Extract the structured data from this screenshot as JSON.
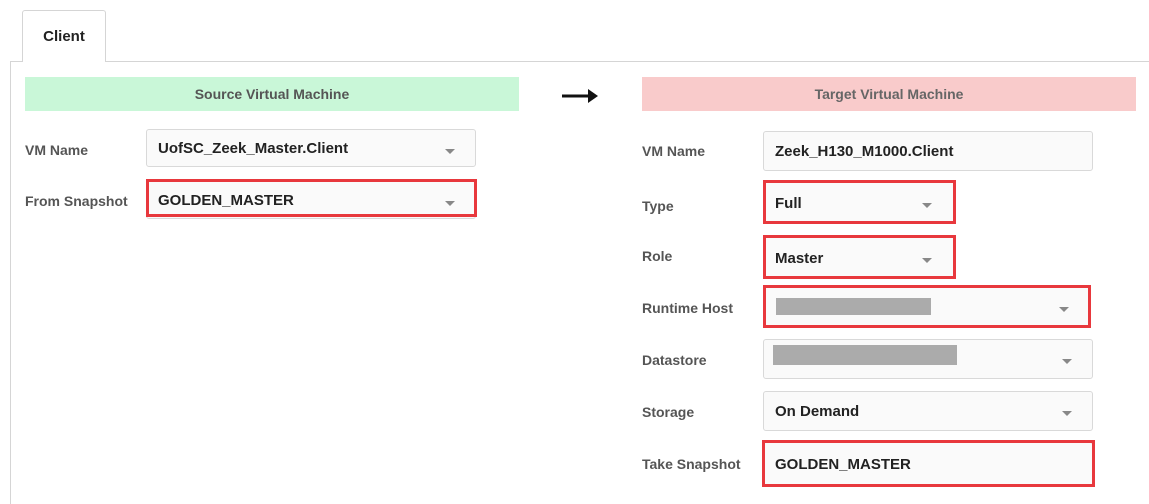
{
  "tabs": [
    {
      "label": "Client"
    }
  ],
  "source": {
    "header": "Source Virtual Machine",
    "vm_name": {
      "label": "VM Name",
      "value": "UofSC_Zeek_Master.Client"
    },
    "from_snapshot": {
      "label": "From Snapshot",
      "value": "GOLDEN_MASTER"
    }
  },
  "arrow_icon": "arrow-right-icon",
  "target": {
    "header": "Target Virtual Machine",
    "vm_name": {
      "label": "VM Name",
      "value": "Zeek_H130_M1000.Client"
    },
    "type": {
      "label": "Type",
      "value": "Full"
    },
    "role": {
      "label": "Role",
      "value": "Master"
    },
    "runtime_host": {
      "label": "Runtime Host",
      "value": ""
    },
    "datastore": {
      "label": "Datastore",
      "value": ""
    },
    "storage": {
      "label": "Storage",
      "value": "On Demand"
    },
    "take_snapshot": {
      "label": "Take Snapshot",
      "value": "GOLDEN_MASTER"
    }
  },
  "colors": {
    "source_header_bg": "#c9f7d8",
    "target_header_bg": "#f9cbcb",
    "highlight": "#e8383d",
    "redaction": "#ababab"
  }
}
